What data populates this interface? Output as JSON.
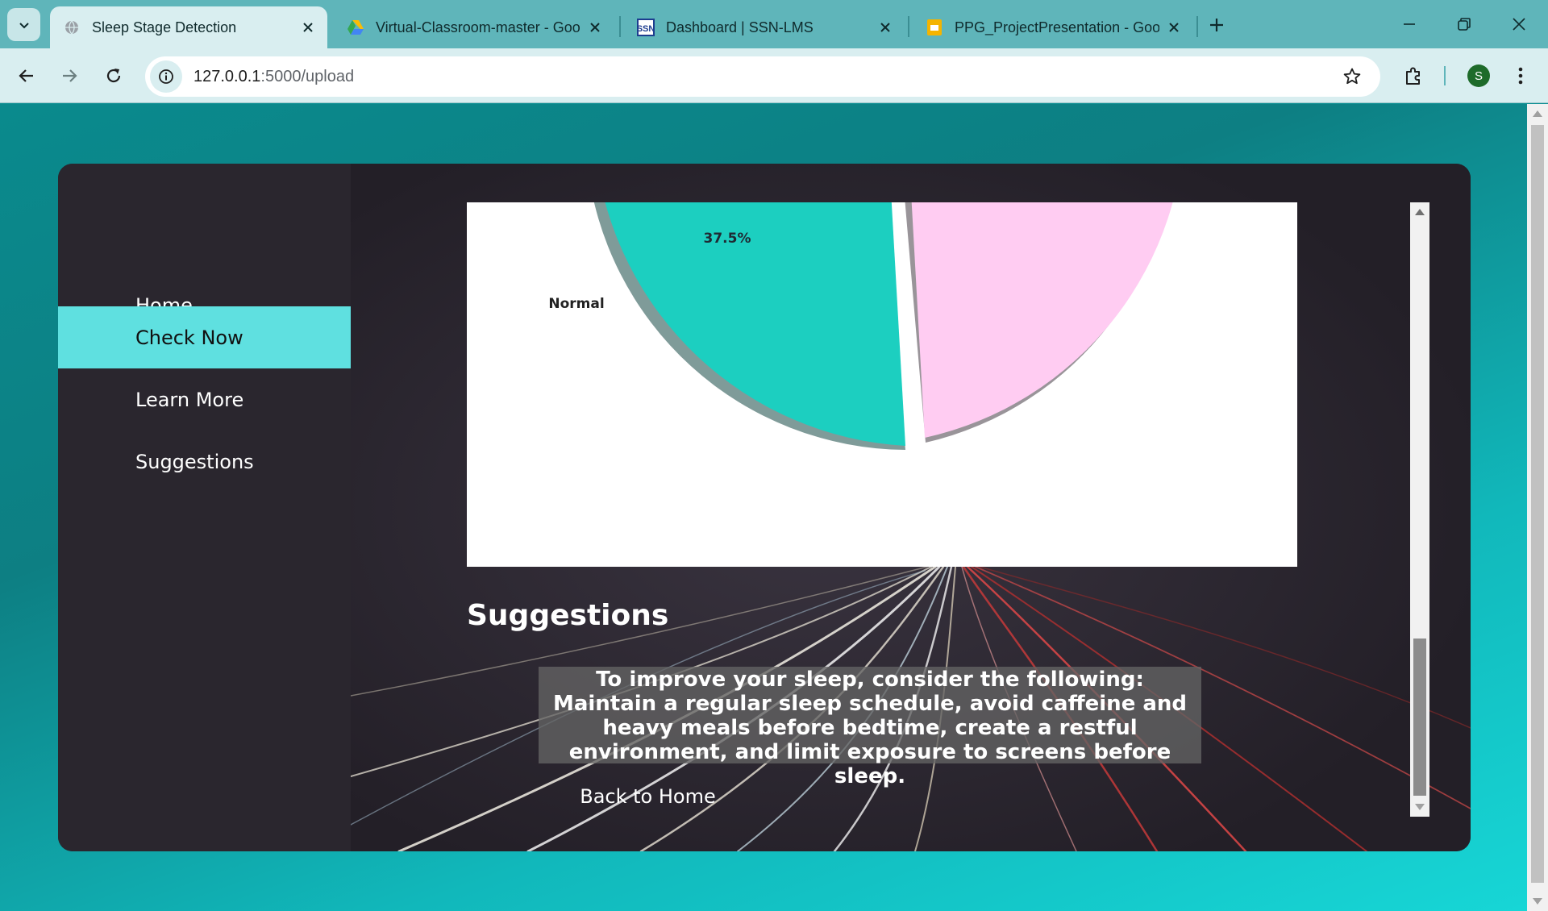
{
  "browser": {
    "tabs": [
      {
        "title": "Sleep Stage Detection",
        "icon": "globe-icon",
        "active": true
      },
      {
        "title": "Virtual-Classroom-master - Goo",
        "icon": "google-drive-icon",
        "active": false
      },
      {
        "title": "Dashboard | SSN-LMS",
        "icon": "ssn-logo-icon",
        "active": false
      },
      {
        "title": "PPG_ProjectPresentation - Goo",
        "icon": "google-slides-icon",
        "active": false
      }
    ],
    "url_host": "127.0.0.1",
    "url_path": ":5000/upload",
    "profile_initial": "S"
  },
  "sidebar": {
    "items": [
      {
        "label": "Home",
        "active": false
      },
      {
        "label": "Check Now",
        "active": true
      },
      {
        "label": "Learn More",
        "active": false
      },
      {
        "label": "Suggestions",
        "active": false
      }
    ]
  },
  "chart_data": {
    "type": "pie",
    "visible_labels": [
      "Normal"
    ],
    "visible_percentages": [
      "37.5%"
    ],
    "slices": [
      {
        "label": "Normal",
        "percent": 37.5,
        "color": "#1ccfc0"
      },
      {
        "label": "",
        "percent": null,
        "color": "#ffccf2"
      }
    ],
    "shadow": true,
    "exploded": true
  },
  "suggestions": {
    "title": "Suggestions",
    "text": "To improve your sleep, consider the following: Maintain a regular sleep schedule, avoid caffeine and heavy meals before bedtime, create a restful environment, and limit exposure to screens before sleep.",
    "back_link": "Back to Home"
  },
  "colors": {
    "accent": "#5fe0e0",
    "card_bg": "#231f27",
    "sidebar_bg": "#2a262e"
  }
}
